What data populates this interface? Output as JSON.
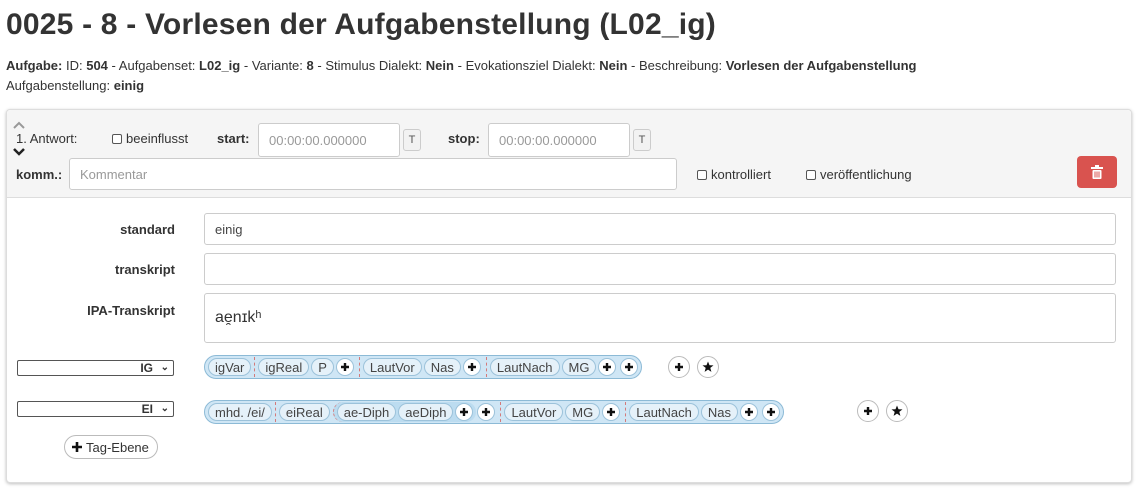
{
  "page_title": "0025 - 8 - Vorlesen der Aufgabenstellung (L02_ig)",
  "meta": {
    "aufgabe_label": "Aufgabe:",
    "id_label": "ID:",
    "id": "504",
    "aufgabenset_label": "Aufgabenset:",
    "aufgabenset": "L02_ig",
    "variante_label": "Variante:",
    "variante": "8",
    "stimulus_label": "Stimulus Dialekt:",
    "stimulus": "Nein",
    "evokation_label": "Evokationsziel Dialekt:",
    "evokation": "Nein",
    "beschreibung_label": "Beschreibung:",
    "beschreibung": "Vorlesen der Aufgabenstellung",
    "aufgabenstellung_label": "Aufgabenstellung:",
    "aufgabenstellung": "einig",
    "separator": "-"
  },
  "answer": {
    "label": "1. Antwort:",
    "beeinflusst_label": "beeinflusst",
    "start_label": "start:",
    "start_placeholder": "00:00:00.000000",
    "stop_label": "stop:",
    "stop_placeholder": "00:00:00.000000",
    "t_button": "T",
    "komm_label": "komm.:",
    "komm_placeholder": "Kommentar",
    "kontrolliert_label": "kontrolliert",
    "veroeffentlichung_label": "veröffentlichung"
  },
  "fields": {
    "standard_label": "standard",
    "standard_value": "einig",
    "transkript_label": "transkript",
    "transkript_value": "",
    "ipa_label": "IPA-Transkript",
    "ipa_value": "ae̯nɪkʰ"
  },
  "tag_rows": [
    {
      "select": "IG",
      "root": "igVar",
      "groups": [
        {
          "chips": [
            "igReal",
            "P"
          ]
        },
        {
          "chips": [
            "LautVor",
            "Nas"
          ]
        },
        {
          "chips": [
            "LautNach",
            "MG"
          ]
        }
      ]
    },
    {
      "select": "EI",
      "root": "mhd. /ei/",
      "groups": [
        {
          "chips": [
            "eiReal"
          ],
          "inner": [
            "ae-Diph",
            "aeDiph"
          ]
        },
        {
          "chips": [
            "LautVor",
            "MG"
          ]
        },
        {
          "chips": [
            "LautNach",
            "Nas"
          ]
        }
      ]
    }
  ],
  "tag_ebene_label": "Tag-Ebene",
  "colors": {
    "danger": "#d9534f",
    "chip_bg": "#cfe6f5",
    "panel_header": "#f5f5f5"
  },
  "icons": {
    "up": "chevron-up-icon",
    "down": "chevron-down-icon",
    "trash": "trash-icon",
    "plus": "plus-icon",
    "star": "star-icon"
  }
}
